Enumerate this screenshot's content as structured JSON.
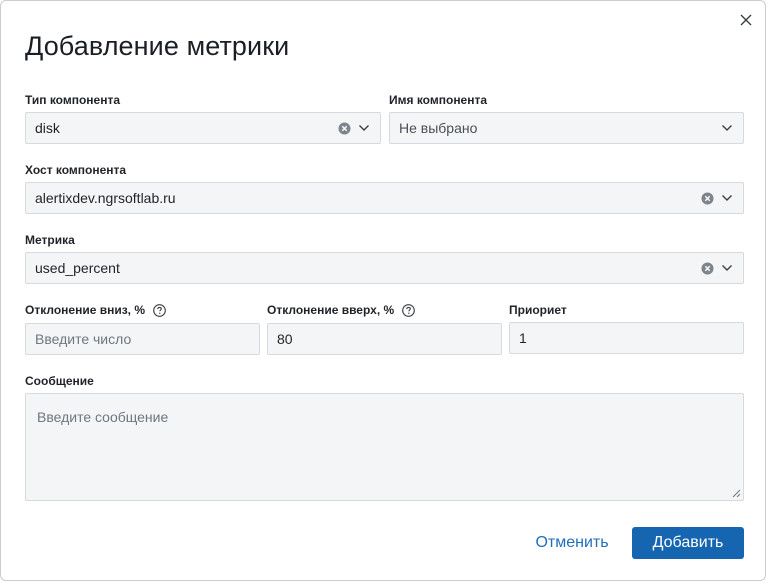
{
  "dialog": {
    "title": "Добавление метрики",
    "close_icon": "close-icon"
  },
  "fields": {
    "component_type": {
      "label": "Тип компонента",
      "value": "disk"
    },
    "component_name": {
      "label": "Имя компонента",
      "value": "Не выбрано"
    },
    "component_host": {
      "label": "Хост компонента",
      "value": "alertixdev.ngrsoftlab.ru"
    },
    "metric": {
      "label": "Метрика",
      "value": "used_percent"
    },
    "deviation_down": {
      "label": "Отклонение вниз, %",
      "placeholder": "Введите число",
      "value": ""
    },
    "deviation_up": {
      "label": "Отклонение вверх, %",
      "value": "80"
    },
    "priority": {
      "label": "Приориет",
      "value": "1"
    },
    "message": {
      "label": "Сообщение",
      "placeholder": "Введите сообщение"
    }
  },
  "buttons": {
    "cancel": "Отменить",
    "add": "Добавить"
  },
  "colors": {
    "primary": "#1565b0",
    "link": "#1f6fbd",
    "field_bg": "#f4f5f6",
    "field_border": "#d6d9dd"
  }
}
